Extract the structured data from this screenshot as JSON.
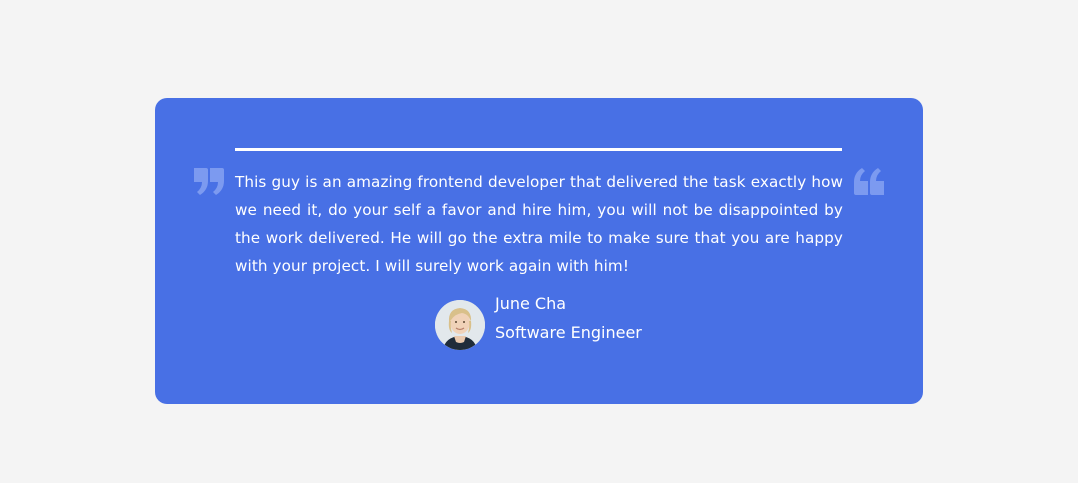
{
  "testimonial": {
    "text": "This guy is an amazing frontend developer that delivered the task exactly how we need it, do your self a favor and hire him, you will not be disappointed by the work delivered. He will go the extra mile to make sure that you are happy with your project. I will surely work again with him!",
    "author": {
      "name": "June Cha",
      "role": "Software Engineer"
    },
    "icons": {
      "left": "closing-quote-icon",
      "right": "opening-quote-icon"
    }
  },
  "colors": {
    "page_background": "#f4f4f4",
    "card_background": "#4870e5",
    "quote_mark": "#7c9af0",
    "text": "#ffffff"
  }
}
